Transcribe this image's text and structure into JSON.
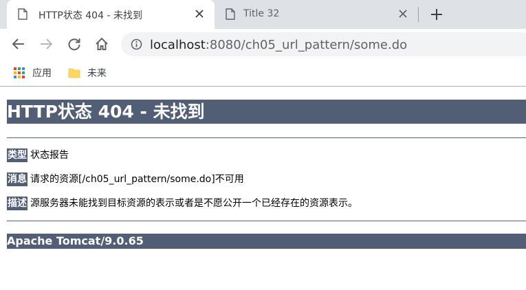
{
  "tabs": [
    {
      "title": "HTTP状态 404 - 未找到",
      "active": true
    },
    {
      "title": "Title 32",
      "active": false
    }
  ],
  "address_bar": {
    "host": "localhost",
    "rest": ":8080/ch05_url_pattern/some.do"
  },
  "bookmarks": [
    {
      "label": "应用",
      "icon": "apps-grid-icon"
    },
    {
      "label": "未来",
      "icon": "folder-icon"
    }
  ],
  "page": {
    "heading": "HTTP状态 404 - 未找到",
    "type_label": "类型",
    "type_value": "状态报告",
    "message_label": "消息",
    "message_value": "请求的资源[/ch05_url_pattern/some.do]不可用",
    "description_label": "描述",
    "description_value": "源服务器未能找到目标资源的表示或者是不愿公开一个已经存在的资源表示。",
    "server_info": "Apache Tomcat/9.0.65"
  },
  "colors": {
    "tomcat_header": "#525d76",
    "tabstrip": "#dee1e6",
    "omnibox": "#f1f3f4"
  }
}
